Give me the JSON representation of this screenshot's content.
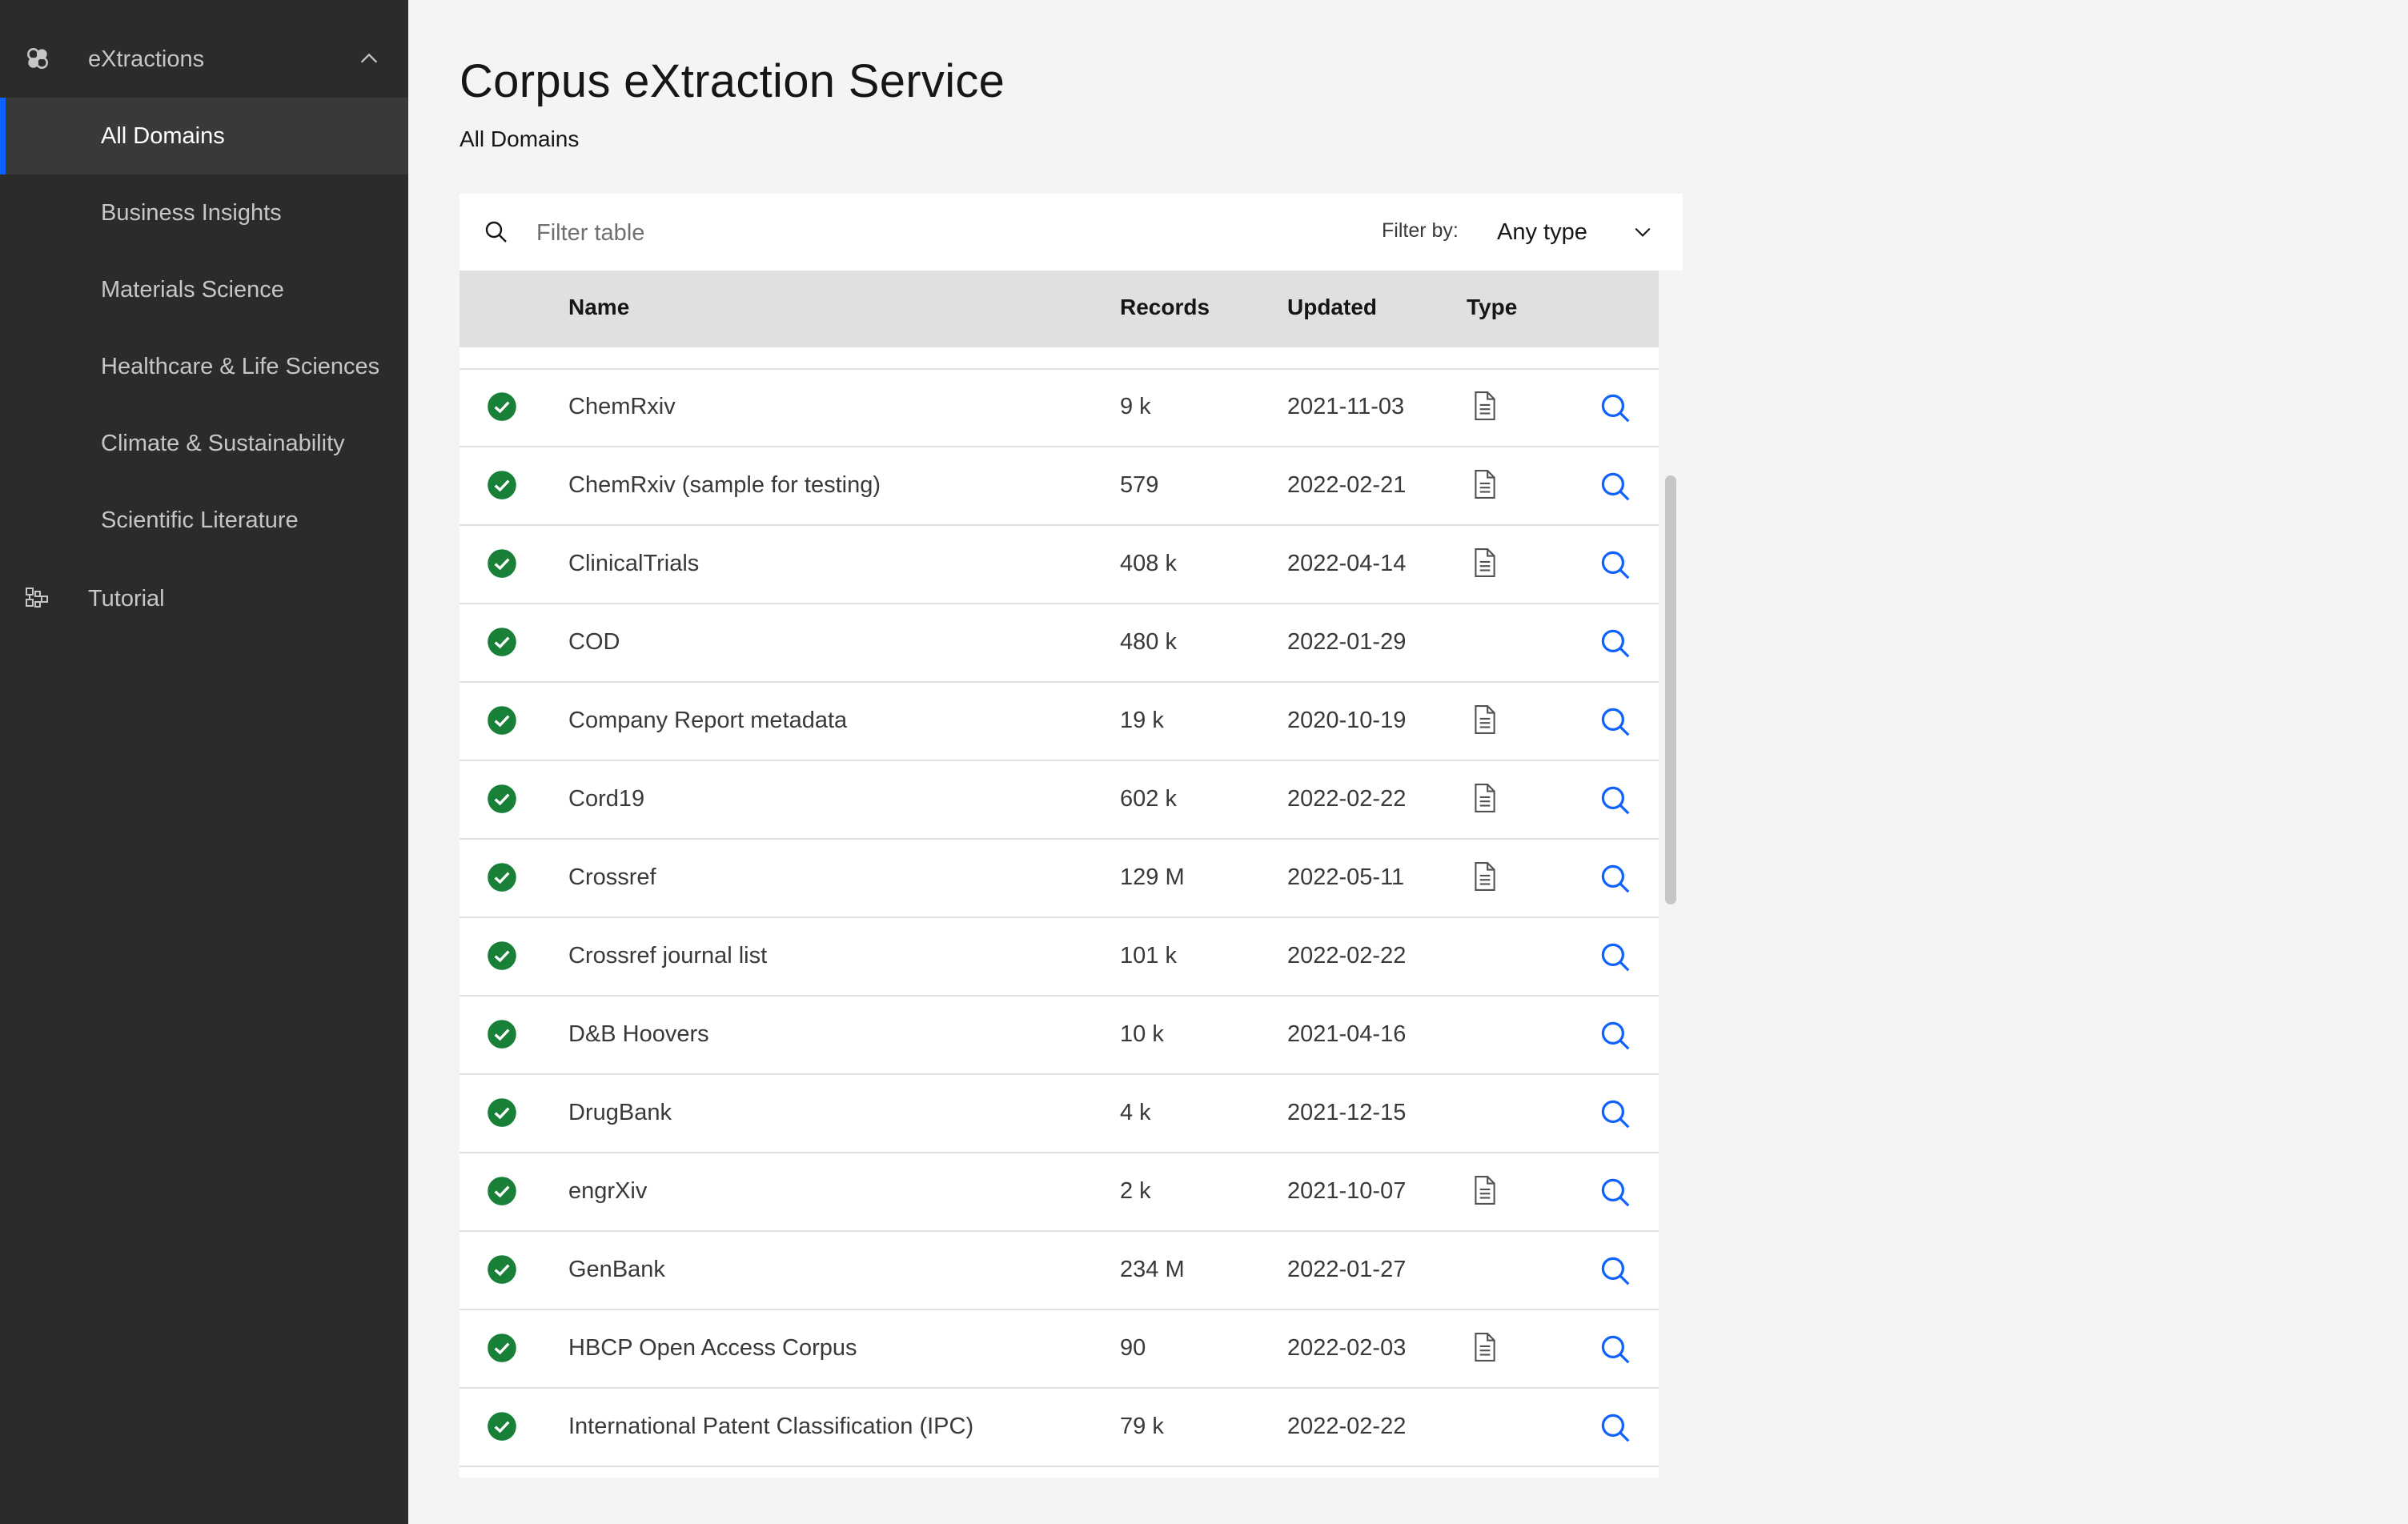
{
  "sidebar": {
    "group_label": "eXtractions",
    "items": [
      {
        "label": "All Domains",
        "active": true
      },
      {
        "label": "Business Insights",
        "active": false
      },
      {
        "label": "Materials Science",
        "active": false
      },
      {
        "label": "Healthcare & Life Sciences",
        "active": false
      },
      {
        "label": "Climate & Sustainability",
        "active": false
      },
      {
        "label": "Scientific Literature",
        "active": false
      }
    ],
    "tutorial_label": "Tutorial"
  },
  "header": {
    "title": "Corpus eXtraction Service",
    "subtitle": "All Domains"
  },
  "toolbar": {
    "search_placeholder": "Filter table",
    "filter_label": "Filter by:",
    "filter_value": "Any type"
  },
  "table": {
    "columns": {
      "name": "Name",
      "records": "Records",
      "updated": "Updated",
      "type": "Type"
    },
    "rows": [
      {
        "name": "ChemRxiv",
        "records": "9 k",
        "updated": "2021-11-03",
        "has_doc": true
      },
      {
        "name": "ChemRxiv (sample for testing)",
        "records": "579",
        "updated": "2022-02-21",
        "has_doc": true
      },
      {
        "name": "ClinicalTrials",
        "records": "408 k",
        "updated": "2022-04-14",
        "has_doc": true
      },
      {
        "name": "COD",
        "records": "480 k",
        "updated": "2022-01-29",
        "has_doc": false
      },
      {
        "name": "Company Report metadata",
        "records": "19 k",
        "updated": "2020-10-19",
        "has_doc": true
      },
      {
        "name": "Cord19",
        "records": "602 k",
        "updated": "2022-02-22",
        "has_doc": true
      },
      {
        "name": "Crossref",
        "records": "129 M",
        "updated": "2022-05-11",
        "has_doc": true
      },
      {
        "name": "Crossref journal list",
        "records": "101 k",
        "updated": "2022-02-22",
        "has_doc": false
      },
      {
        "name": "D&B Hoovers",
        "records": "10 k",
        "updated": "2021-04-16",
        "has_doc": false
      },
      {
        "name": "DrugBank",
        "records": "4 k",
        "updated": "2021-12-15",
        "has_doc": false
      },
      {
        "name": "engrXiv",
        "records": "2 k",
        "updated": "2021-10-07",
        "has_doc": true
      },
      {
        "name": "GenBank",
        "records": "234 M",
        "updated": "2022-01-27",
        "has_doc": false
      },
      {
        "name": "HBCP Open Access Corpus",
        "records": "90",
        "updated": "2022-02-03",
        "has_doc": true
      },
      {
        "name": "International Patent Classification (IPC)",
        "records": "79 k",
        "updated": "2022-02-22",
        "has_doc": false
      }
    ]
  },
  "colors": {
    "sidebar_bg": "#2b2b2b",
    "sidebar_active_bg": "#393939",
    "accent": "#0f62fe",
    "status_ok": "#198038",
    "link_icon": "#0f62fe",
    "header_row_bg": "#e0e0e0",
    "page_bg": "#f4f4f4"
  },
  "icons": {
    "group": "extractions-icon",
    "group_toggle": "chevron-up-icon",
    "tutorial": "tutorial-icon",
    "search": "search-icon",
    "filter_dropdown": "chevron-down-icon",
    "status": "checkmark-filled-icon",
    "type": "document-icon",
    "action": "magnifier-icon"
  }
}
